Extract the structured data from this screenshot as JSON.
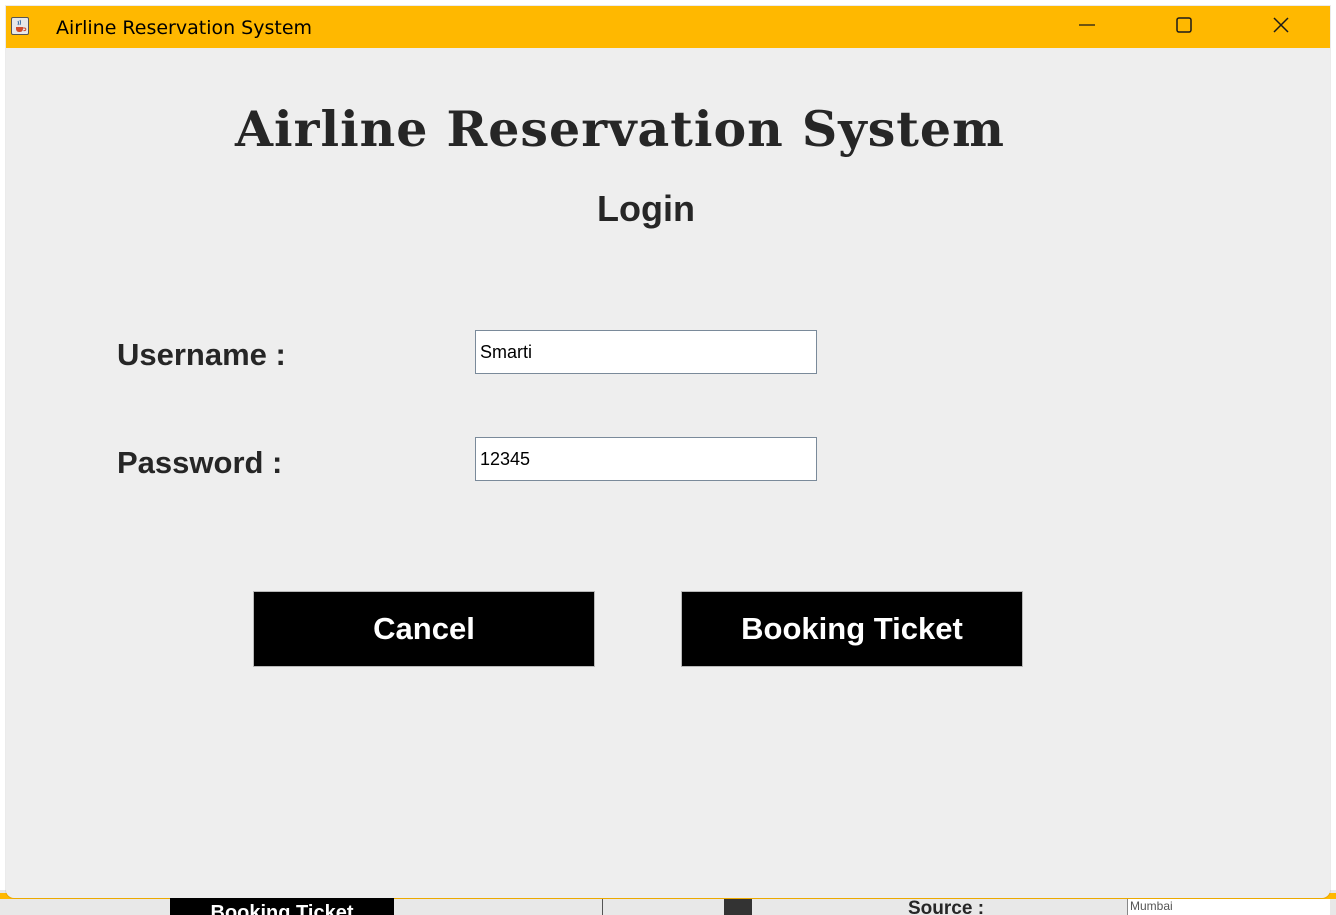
{
  "window": {
    "title": "Airline Reservation System",
    "titlebar_color": "#ffb800",
    "icon": "java-cup-icon",
    "controls": {
      "minimize_icon": "minimize-icon",
      "maximize_icon": "maximize-icon",
      "close_icon": "close-icon"
    }
  },
  "form": {
    "heading": "Airline Reservation System",
    "subheading": "Login",
    "username_label": "Username :",
    "username_value": "Smarti",
    "password_label": "Password :",
    "password_value": "12345"
  },
  "buttons": {
    "cancel_label": "Cancel",
    "booking_label": "Booking Ticket",
    "background_color": "#000000",
    "text_color": "#ffffff"
  },
  "background_window": {
    "booking_button_label": "Booking Ticket",
    "source_label": "Source :",
    "source_value": "Mumbai"
  }
}
